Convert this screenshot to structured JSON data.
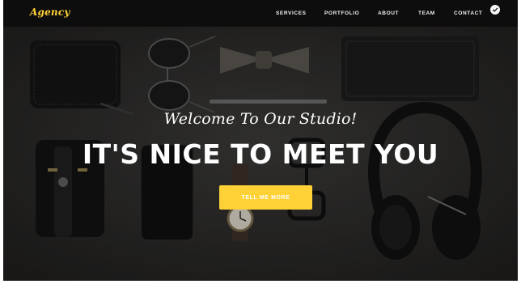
{
  "brand": {
    "name": "Agency"
  },
  "nav": {
    "items": [
      {
        "label": "SERVICES"
      },
      {
        "label": "PORTFOLIO"
      },
      {
        "label": "ABOUT"
      },
      {
        "label": "TEAM"
      },
      {
        "label": "CONTACT"
      }
    ],
    "toggle_icon": "check-circle-icon"
  },
  "hero": {
    "subtitle": "Welcome To Our Studio!",
    "title": "IT'S NICE TO MEET YOU",
    "cta_label": "TELL ME MORE"
  },
  "colors": {
    "accent": "#fed136",
    "navbar": "#0d0d0d",
    "hero_background": "#2c2b2a"
  }
}
